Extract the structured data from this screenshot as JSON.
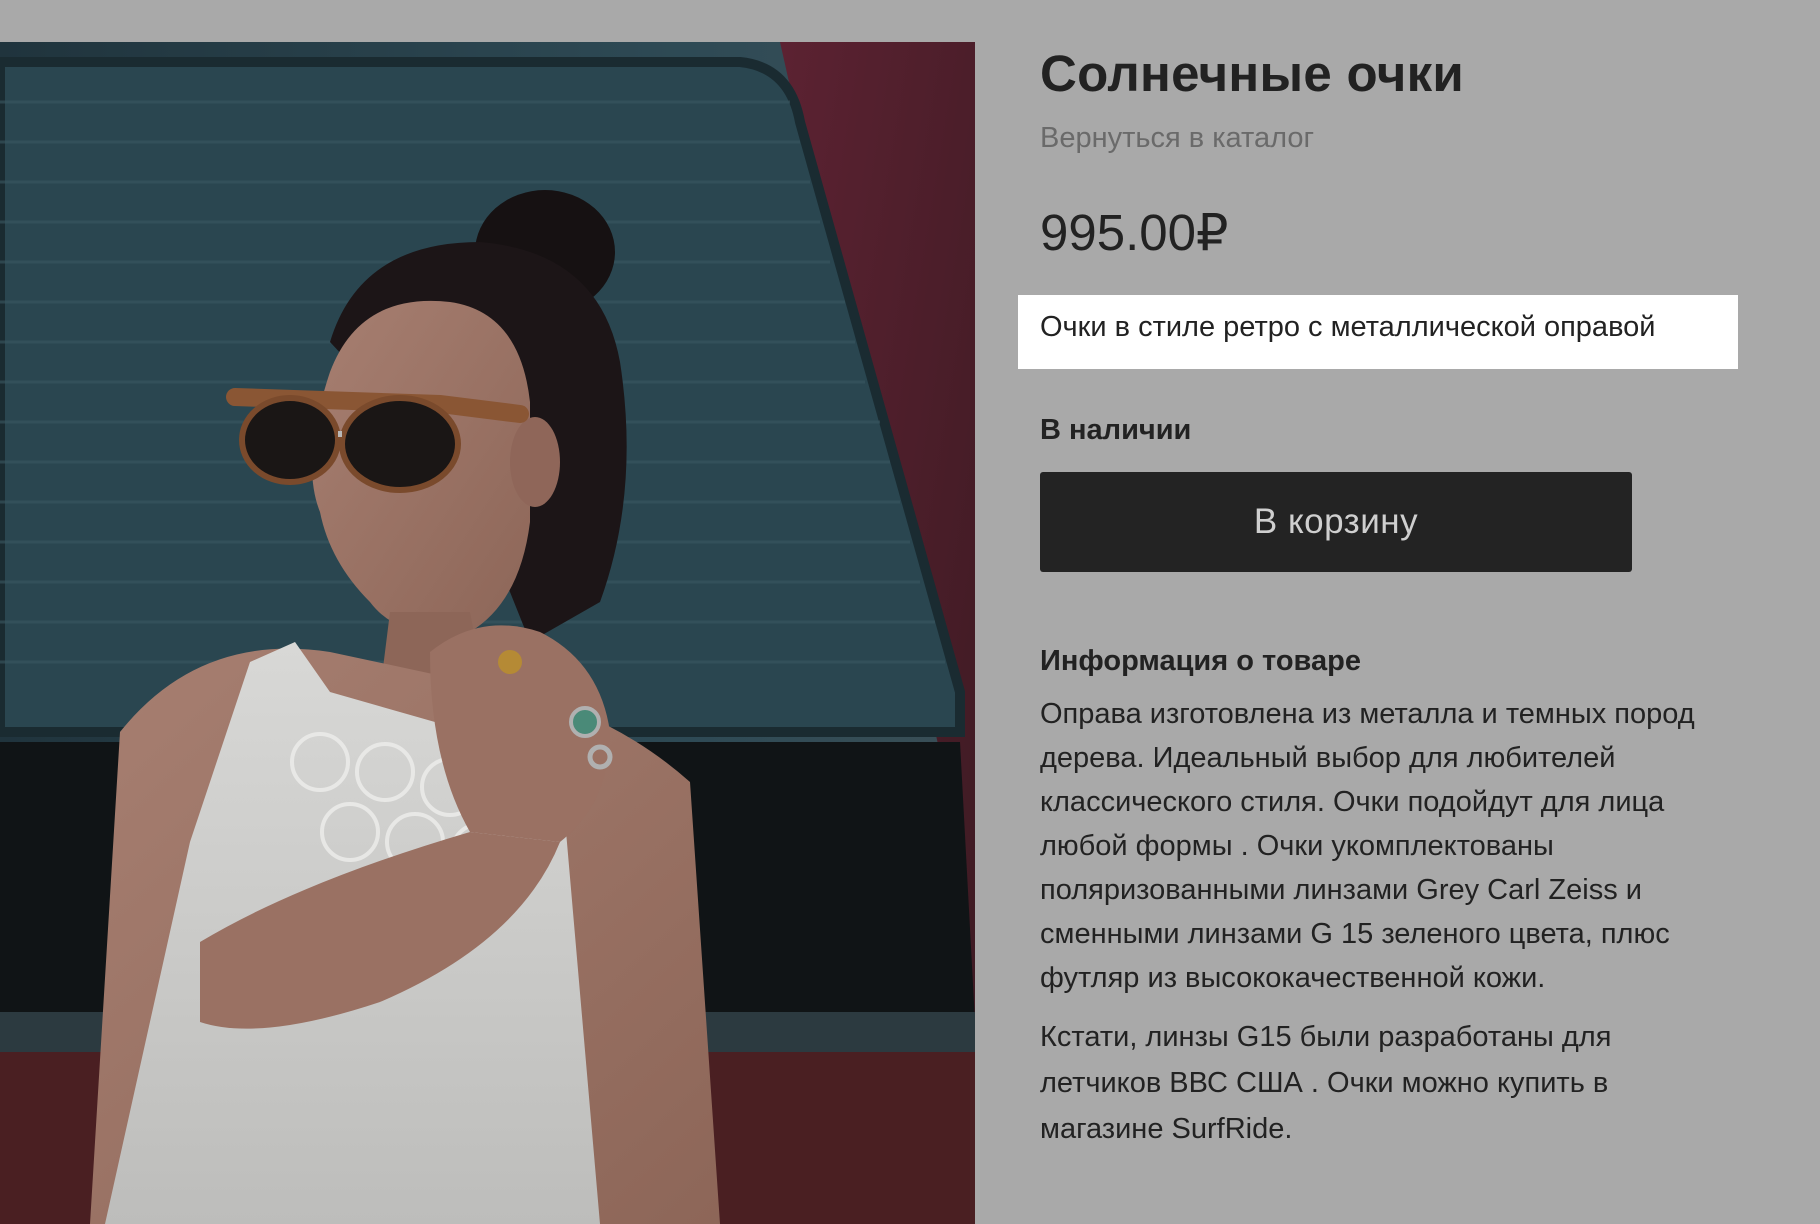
{
  "product": {
    "title": "Солнечные очки",
    "back_link": "Вернуться в каталог",
    "price": "995.00₽",
    "tagline": "Очки в стиле ретро с металлической оправой",
    "stock_status": "В наличии",
    "add_to_cart_label": "В корзину"
  },
  "details": {
    "heading": "Информация о товаре",
    "paragraph_1": [
      "Оправа изготовлена из металла и темных пород",
      "дерева. Идеальный выбор для любителей",
      "классического стиля. Очки подойдут для лица",
      "любой формы . Очки укомплектованы",
      "поляризованными линзами Grey Carl Zeiss и",
      "сменными линзами G 15 зеленого цвета, плюс",
      "футляр из высококачественной кожи."
    ],
    "paragraph_2": [
      "Кстати, линзы G15 были разработаны для",
      "летчиков ВВС США . Очки можно купить в",
      "магазине SurfRide."
    ]
  },
  "image": {
    "icon": "product-photo-woman-sunglasses"
  },
  "colors": {
    "background": "#a9a9a9",
    "button": "#232323",
    "button_text": "#cfcfcf",
    "highlight": "#ffffff",
    "muted_text": "#6a6a6a"
  }
}
